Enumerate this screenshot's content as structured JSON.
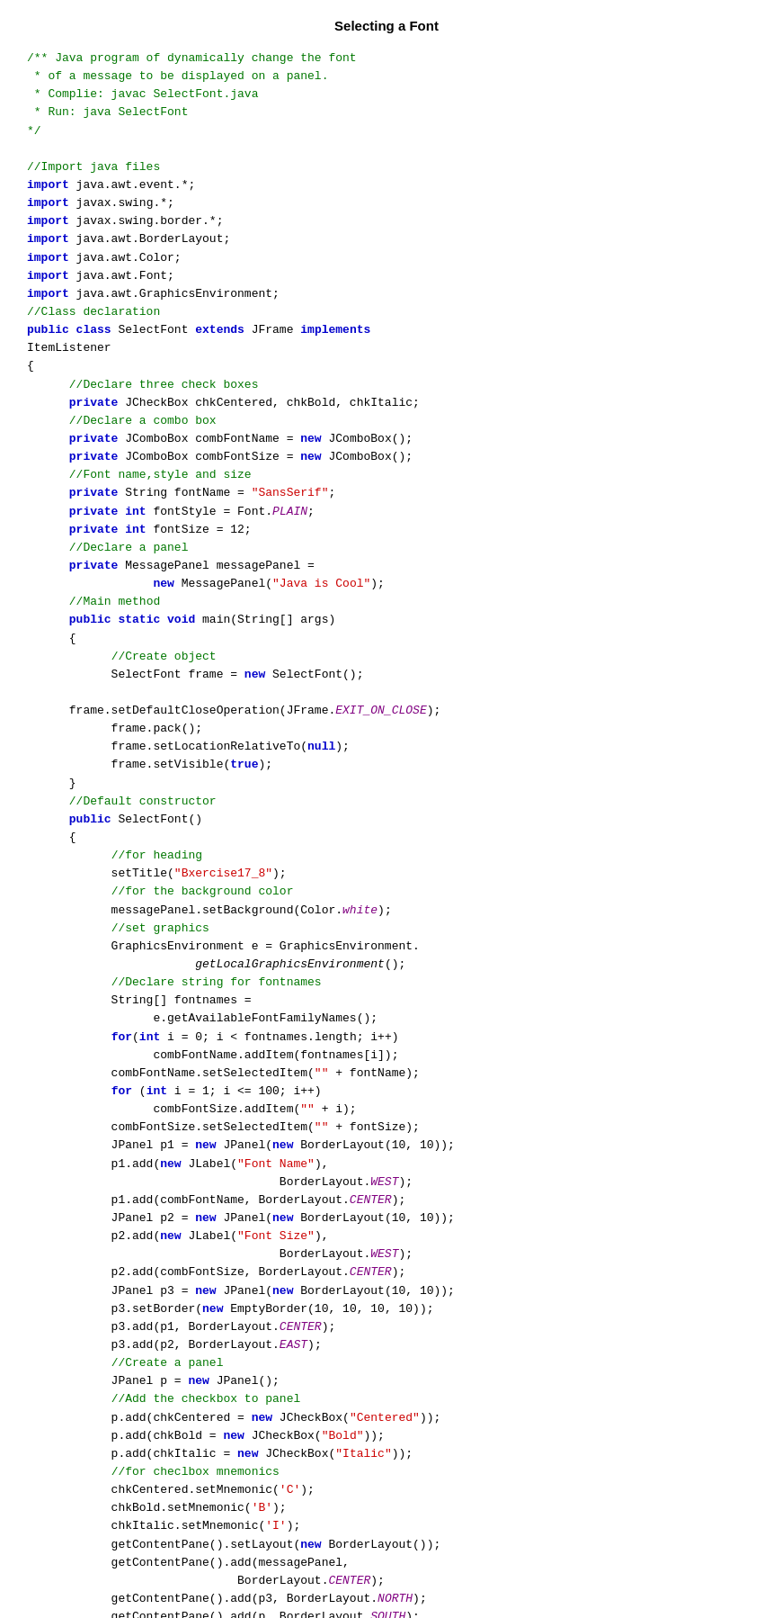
{
  "page": {
    "title": "Selecting a Font"
  },
  "code": {
    "lines": []
  }
}
